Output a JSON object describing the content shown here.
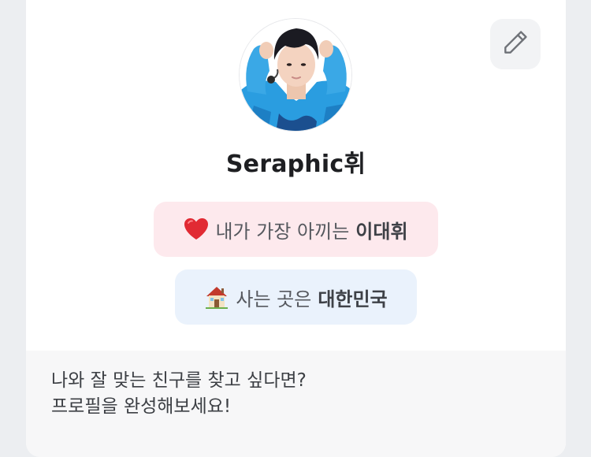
{
  "profile": {
    "nickname": "Seraphic휘",
    "avatar": "profile-photo",
    "edit_icon": "pencil-icon"
  },
  "favorite": {
    "emoji": "heart-icon",
    "prefix": "내가 가장 아끼는",
    "value": "이대휘"
  },
  "location": {
    "emoji": "house-icon",
    "prefix": "사는 곳은",
    "value": "대한민국"
  },
  "prompt": {
    "line1": "나와 잘 맞는 친구를 찾고 싶다면?",
    "line2": "프로필을 완성해보세요!"
  },
  "colors": {
    "favorite_pill_bg": "#fde9ed",
    "location_pill_bg": "#eaf2fc",
    "edit_button_bg": "#f2f3f5",
    "page_bg": "#eceef1"
  }
}
